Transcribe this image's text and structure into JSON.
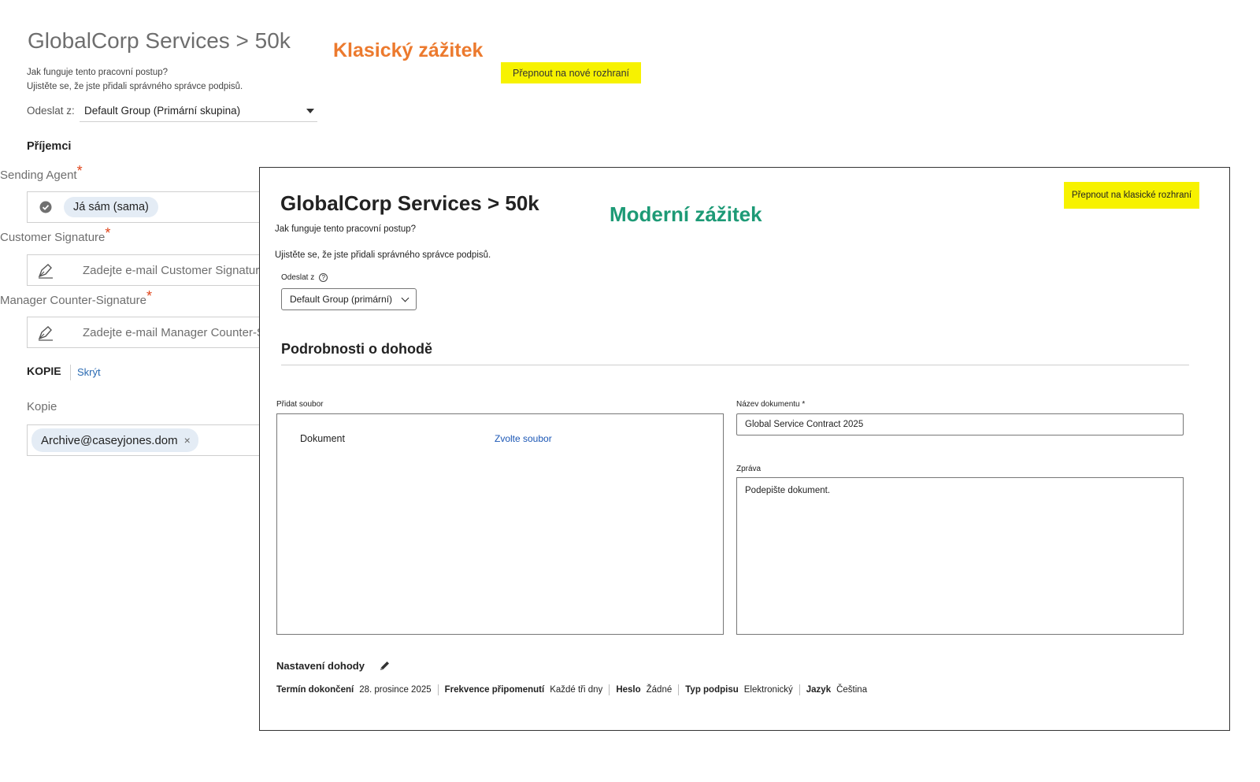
{
  "classic": {
    "title": "GlobalCorp Services > 50k",
    "tag": "Klasický zážitek",
    "switch_label": "Přepnout na nové rozhraní",
    "help_line1": "Jak funguje tento pracovní postup?",
    "help_line2": "Ujistěte se, že jste přidali správného správce podpisů.",
    "send_from_label": "Odeslat z:",
    "send_from_value": "Default Group (Primární skupina)",
    "recipients_heading": "Příjemci",
    "sending_agent_label": "Sending Agent",
    "sending_agent_value": "Já sám (sama)",
    "customer_signature_label": "Customer Signature",
    "customer_signature_placeholder": "Zadejte e-mail Customer Signature",
    "manager_label": "Manager Counter-Signature",
    "manager_placeholder": "Zadejte e-mail Manager Counter-Signature",
    "required_mark": "*",
    "copies_heading": "KOPIE",
    "hide_link": "Skrýt",
    "cc_label": "Kopie",
    "cc_value": "Archive@caseyjones.dom",
    "cc_remove": "×"
  },
  "modern": {
    "title": "GlobalCorp Services > 50k",
    "tag": "Moderní zážitek",
    "switch_label": "Přepnout na klasické rozhraní",
    "help_line1": "Jak funguje tento pracovní postup?",
    "help_line2": "Ujistěte se, že jste přidali správného správce podpisů.",
    "send_from_label": "Odeslat z",
    "help_icon": "?",
    "send_from_value": "Default Group (primární)",
    "details_heading": "Podrobnosti o dohodě",
    "add_file_label": "Přidat soubor",
    "document_label": "Dokument",
    "choose_file": "Zvolte soubor",
    "doc_name_label": "Název dokumentu *",
    "doc_name_value": "Global Service Contract 2025",
    "message_label": "Zpráva",
    "message_value": "Podepište dokument.",
    "settings_heading": "Nastavení dohody",
    "settings": [
      {
        "key": "Termín dokončení",
        "value": "28. prosince 2025"
      },
      {
        "key": "Frekvence připomenutí",
        "value": "Každé tři dny"
      },
      {
        "key": "Heslo",
        "value": "Žádné"
      },
      {
        "key": "Typ podpisu",
        "value": "Elektronický"
      },
      {
        "key": "Jazyk",
        "value": "Čeština"
      }
    ]
  },
  "colors": {
    "classic_tag": "#ec7a2e",
    "modern_tag": "#1d9a76",
    "highlight": "#f7f200",
    "link": "#1a56b5",
    "required": "#e0441a"
  },
  "icons": {
    "sending_agent": "check-circle-icon",
    "signature": "pen-icon",
    "settings_edit": "pencil-icon",
    "dropdown": "chevron-down-icon"
  }
}
